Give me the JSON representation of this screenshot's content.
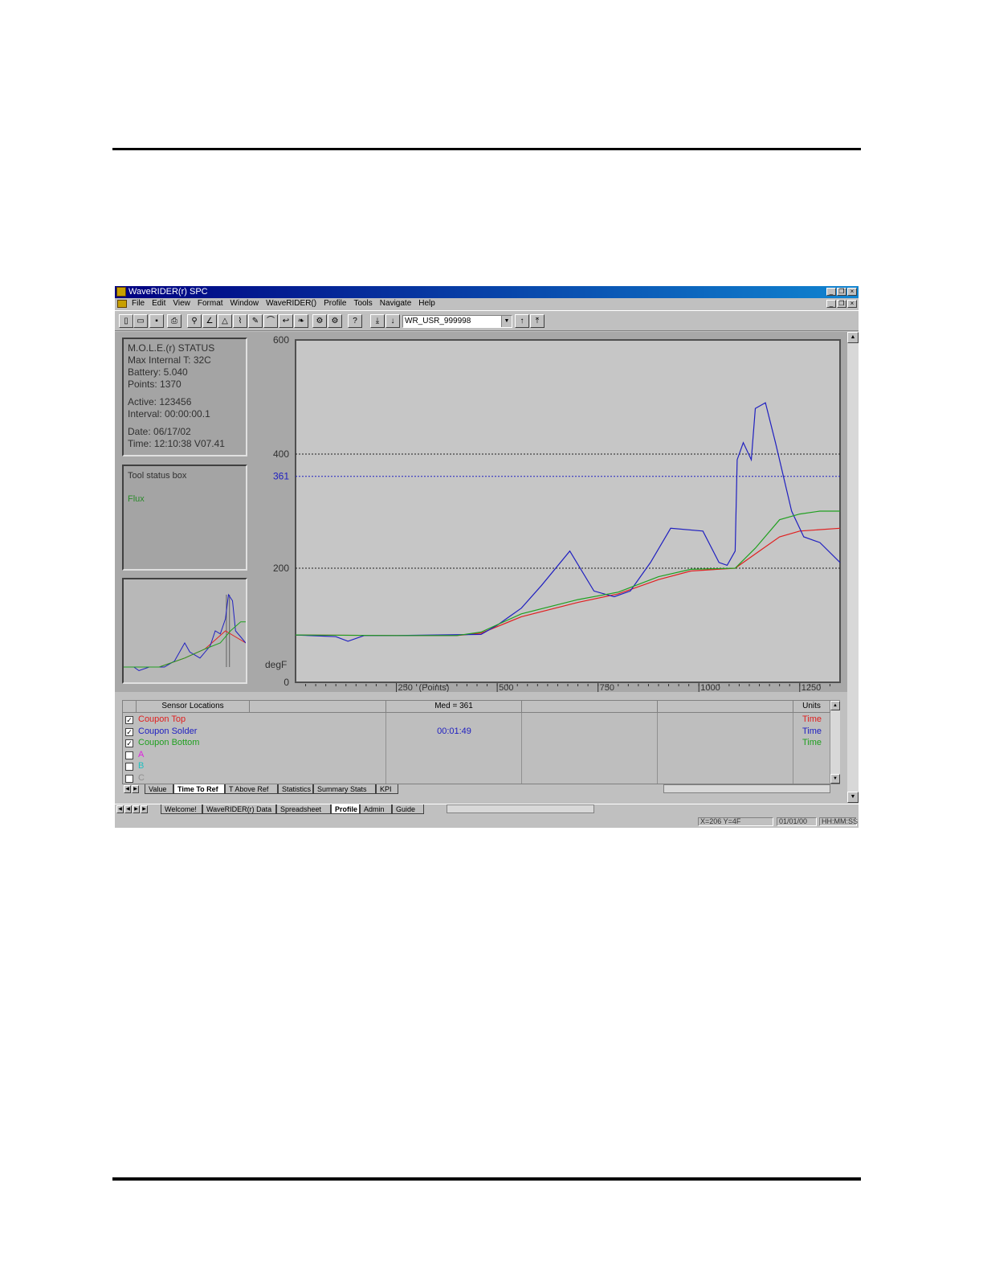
{
  "window": {
    "title": "WaveRIDER(r) SPC"
  },
  "menu": [
    "File",
    "Edit",
    "View",
    "Format",
    "Window",
    "WaveRIDER()",
    "Profile",
    "Tools",
    "Navigate",
    "Help"
  ],
  "toolbar": {
    "combo_value": "WR_USR_999998"
  },
  "status_box": {
    "title": "M.O.L.E.(r) STATUS",
    "max_internal": "Max Internal T: 32C",
    "battery": "Battery: 5.040",
    "points": "Points: 1370",
    "active": "Active: 123456",
    "interval": "Interval: 00:00:00.1",
    "date": "Date: 06/17/02",
    "time": "Time: 12:10:38   V07.41"
  },
  "tool_status": {
    "title": "Tool status box",
    "flux": "Flux"
  },
  "colors": {
    "top": "#e02020",
    "solder": "#2020c0",
    "bottom": "#20a020",
    "a": "#e020e0",
    "b": "#20c0c0",
    "c": "#909090"
  },
  "chart_data": {
    "type": "line",
    "ylabel": "degF",
    "xlabel": "(Points)",
    "xlim": [
      0,
      1350
    ],
    "ylim": [
      0,
      600
    ],
    "y_ticks": [
      "600",
      "400",
      "200",
      "0"
    ],
    "x_ticks": [
      "250",
      "500",
      "750",
      "1000",
      "1250"
    ],
    "ref_line": {
      "value": 361,
      "label": "361"
    },
    "series": [
      {
        "name": "Coupon Top",
        "color": "#e02020",
        "points": [
          [
            0,
            83
          ],
          [
            250,
            82
          ],
          [
            400,
            82
          ],
          [
            460,
            86
          ],
          [
            560,
            115
          ],
          [
            700,
            140
          ],
          [
            800,
            155
          ],
          [
            900,
            180
          ],
          [
            980,
            195
          ],
          [
            1090,
            200
          ],
          [
            1140,
            225
          ],
          [
            1200,
            255
          ],
          [
            1250,
            265
          ],
          [
            1350,
            270
          ]
        ]
      },
      {
        "name": "Coupon Solder",
        "color": "#2020c0",
        "points": [
          [
            0,
            83
          ],
          [
            100,
            80
          ],
          [
            130,
            72
          ],
          [
            170,
            82
          ],
          [
            250,
            82
          ],
          [
            460,
            84
          ],
          [
            500,
            100
          ],
          [
            560,
            130
          ],
          [
            610,
            170
          ],
          [
            680,
            230
          ],
          [
            740,
            160
          ],
          [
            790,
            150
          ],
          [
            830,
            160
          ],
          [
            880,
            210
          ],
          [
            930,
            270
          ],
          [
            1010,
            265
          ],
          [
            1050,
            210
          ],
          [
            1070,
            205
          ],
          [
            1090,
            230
          ],
          [
            1095,
            390
          ],
          [
            1110,
            420
          ],
          [
            1130,
            390
          ],
          [
            1140,
            480
          ],
          [
            1165,
            490
          ],
          [
            1190,
            420
          ],
          [
            1230,
            300
          ],
          [
            1260,
            255
          ],
          [
            1300,
            245
          ],
          [
            1350,
            210
          ]
        ]
      },
      {
        "name": "Coupon Bottom",
        "color": "#20a020",
        "points": [
          [
            0,
            83
          ],
          [
            250,
            82
          ],
          [
            400,
            82
          ],
          [
            460,
            88
          ],
          [
            560,
            120
          ],
          [
            700,
            145
          ],
          [
            800,
            158
          ],
          [
            900,
            185
          ],
          [
            980,
            198
          ],
          [
            1090,
            200
          ],
          [
            1140,
            235
          ],
          [
            1200,
            285
          ],
          [
            1250,
            295
          ],
          [
            1300,
            300
          ],
          [
            1350,
            300
          ]
        ]
      }
    ],
    "mini_series": [
      {
        "name": "Coupon Top",
        "color": "#e02020",
        "points": [
          [
            0,
            20
          ],
          [
            350,
            20
          ],
          [
            600,
            35
          ],
          [
            800,
            50
          ],
          [
            1000,
            80
          ],
          [
            1100,
            70
          ],
          [
            1200,
            60
          ]
        ]
      },
      {
        "name": "Coupon Solder",
        "color": "#2020c0",
        "points": [
          [
            0,
            20
          ],
          [
            100,
            20
          ],
          [
            150,
            14
          ],
          [
            250,
            20
          ],
          [
            400,
            20
          ],
          [
            500,
            30
          ],
          [
            600,
            60
          ],
          [
            650,
            45
          ],
          [
            750,
            35
          ],
          [
            850,
            55
          ],
          [
            900,
            80
          ],
          [
            950,
            75
          ],
          [
            1000,
            100
          ],
          [
            1030,
            140
          ],
          [
            1070,
            130
          ],
          [
            1100,
            80
          ],
          [
            1150,
            70
          ],
          [
            1200,
            60
          ]
        ]
      },
      {
        "name": "Coupon Bottom",
        "color": "#20a020",
        "points": [
          [
            0,
            20
          ],
          [
            350,
            20
          ],
          [
            600,
            35
          ],
          [
            800,
            50
          ],
          [
            950,
            60
          ],
          [
            1050,
            80
          ],
          [
            1150,
            95
          ],
          [
            1200,
            95
          ]
        ]
      }
    ]
  },
  "grid": {
    "headers": [
      "Sensor Locations",
      "",
      "Med = 361",
      "",
      "",
      "Units"
    ],
    "rows": [
      {
        "label": "Coupon Top",
        "checked": "✓",
        "value": "",
        "units": "Time"
      },
      {
        "label": "Coupon Solder",
        "checked": "✓",
        "value": "00:01:49",
        "units": "Time"
      },
      {
        "label": "Coupon Bottom",
        "checked": "✓",
        "value": "",
        "units": "Time"
      },
      {
        "label": "A",
        "checked": "",
        "value": "",
        "units": ""
      },
      {
        "label": "B",
        "checked": "",
        "value": "",
        "units": ""
      },
      {
        "label": "C",
        "checked": "",
        "value": "",
        "units": ""
      }
    ]
  },
  "tabs_inner": [
    "Value",
    "Time To Ref",
    "T Above Ref",
    "Statistics",
    "Summary Stats",
    "KPI"
  ],
  "tabs_outer": [
    "Welcome!",
    "WaveRIDER(r) Data",
    "Spreadsheet",
    "Profile",
    "Admin",
    "Guide"
  ],
  "statusbar": {
    "coords": "X=206 Y=4F",
    "date": "01/01/00",
    "format": "HH:MM:SS"
  }
}
